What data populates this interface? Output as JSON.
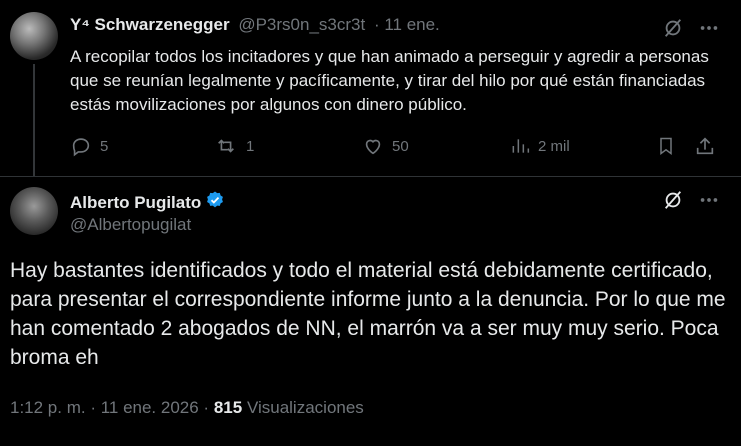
{
  "tweet1": {
    "author_name": "Schwarzenegger",
    "author_prefix": "Y⁴",
    "handle": "@P3rs0n_s3cr3t",
    "date": "· 11 ene.",
    "text": "A recopilar todos los incitadores y que han animado a perseguir y agredir a personas que se reunían legalmente y pacíficamente, y tirar del hilo por qué están financiadas estás movilizaciones por algunos con dinero público.",
    "replies": "5",
    "reposts": "1",
    "likes": "50",
    "views": "2 mil"
  },
  "tweet2": {
    "author_name": "Alberto Pugilato",
    "handle": "@Albertopugilat",
    "text": "Hay bastantes identificados y todo el material está debidamente certificado, para presentar el correspondiente informe junto a la denuncia. Por lo que me han comentado 2 abogados de NN, el marrón va a ser muy muy serio. Poca broma eh",
    "timestamp": "1:12 p. m. · 11 ene. 2026 ·",
    "views_count": "815",
    "views_label": "Visualizaciones"
  },
  "colors": {
    "background": "#000000",
    "text": "#e7e9ea",
    "muted": "#71767b",
    "verified": "#1d9bf0"
  },
  "icons": [
    "grok-icon",
    "more-icon",
    "reply-icon",
    "repost-icon",
    "like-icon",
    "views-icon",
    "bookmark-icon",
    "share-icon",
    "verified-badge-icon"
  ]
}
